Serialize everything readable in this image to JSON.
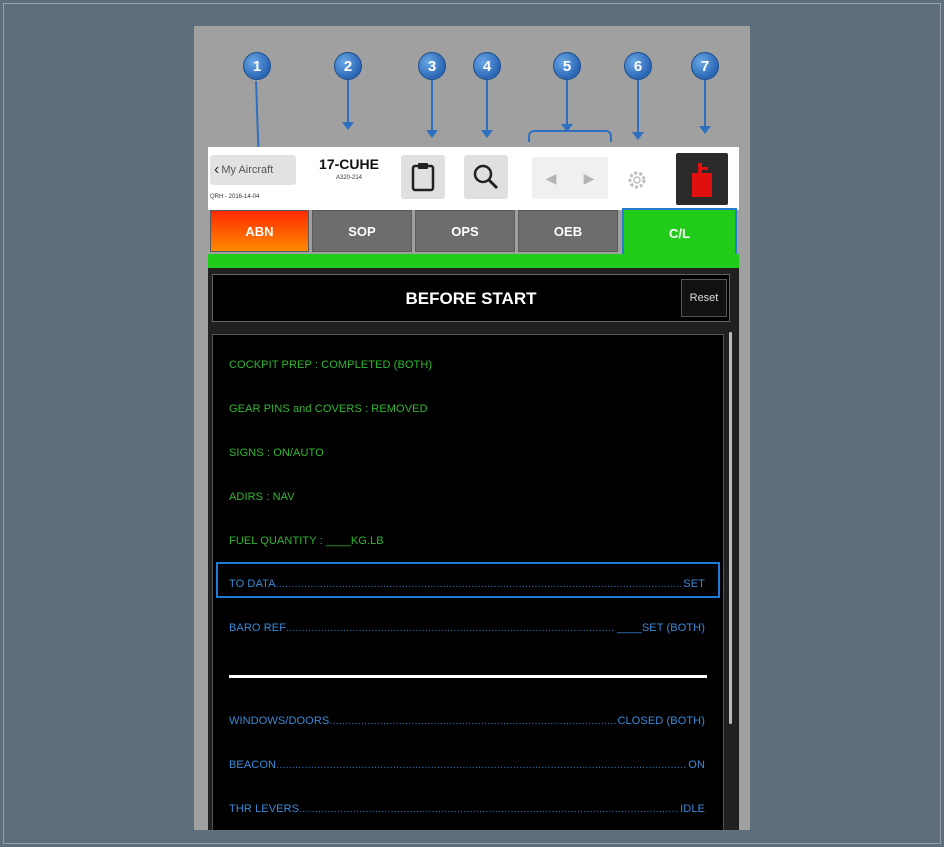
{
  "callouts": [
    "1",
    "2",
    "3",
    "4",
    "5",
    "6",
    "7"
  ],
  "header": {
    "back_label": "My Aircraft",
    "qrh_date": "QRH - 2016-14-04",
    "registration": "17-CUHE",
    "aircraft_type": "A320-214"
  },
  "tabs": [
    {
      "label": "ABN"
    },
    {
      "label": "SOP"
    },
    {
      "label": "OPS"
    },
    {
      "label": "OEB"
    },
    {
      "label": "C/L",
      "active": true
    }
  ],
  "checklist": {
    "title": "BEFORE START",
    "reset_label": "Reset",
    "green_items": [
      "COCKPIT PREP : COMPLETED (BOTH)",
      "GEAR PINS and COVERS : REMOVED",
      "SIGNS : ON/AUTO",
      "ADIRS : NAV",
      "FUEL QUANTITY : ____KG.LB"
    ],
    "blue_items": [
      {
        "label": "TO DATA",
        "value": "SET"
      },
      {
        "label": "BARO REF",
        "value": "____SET (BOTH)"
      },
      {
        "label": "WINDOWS/DOORS",
        "value": "CLOSED (BOTH)"
      },
      {
        "label": "BEACON",
        "value": "ON"
      },
      {
        "label": "THR LEVERS",
        "value": "IDLE"
      }
    ]
  },
  "colors": {
    "abn_gradient": [
      "#ff2a00",
      "#ff8a00"
    ],
    "active_tab": "#22cc1a",
    "checked_item": "#2fb82f",
    "pending_item": "#3b8ad8",
    "callout": "#2a66b4"
  }
}
